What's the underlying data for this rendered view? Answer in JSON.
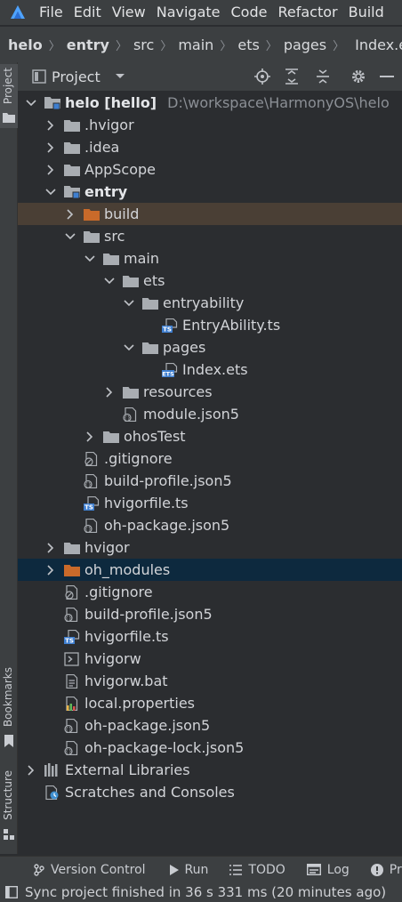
{
  "menu": [
    "File",
    "Edit",
    "View",
    "Navigate",
    "Code",
    "Refactor",
    "Build"
  ],
  "breadcrumb": [
    "helo",
    "entry",
    "src",
    "main",
    "ets",
    "pages",
    "Index.ets"
  ],
  "sidebar": {
    "project_tab": "Project",
    "bookmarks_tab": "Bookmarks",
    "structure_tab": "Structure"
  },
  "panel": {
    "title": "Project"
  },
  "tree": [
    {
      "label": "helo [hello]",
      "path": "D:\\workspace\\HarmonyOS\\helo",
      "level": 0,
      "expanded": true,
      "icon": "module-folder-icon",
      "bold": true
    },
    {
      "label": ".hvigor",
      "level": 1,
      "expanded": false,
      "icon": "folder-icon"
    },
    {
      "label": ".idea",
      "level": 1,
      "expanded": false,
      "icon": "folder-icon"
    },
    {
      "label": "AppScope",
      "level": 1,
      "expanded": false,
      "icon": "folder-icon"
    },
    {
      "label": "entry",
      "level": 1,
      "expanded": true,
      "icon": "module-folder-icon",
      "bold": true
    },
    {
      "label": "build",
      "level": 2,
      "expanded": false,
      "icon": "excluded-folder-icon",
      "selected": "brown"
    },
    {
      "label": "src",
      "level": 2,
      "expanded": true,
      "icon": "folder-icon"
    },
    {
      "label": "main",
      "level": 3,
      "expanded": true,
      "icon": "folder-icon"
    },
    {
      "label": "ets",
      "level": 4,
      "expanded": true,
      "icon": "folder-icon"
    },
    {
      "label": "entryability",
      "level": 5,
      "expanded": true,
      "icon": "folder-icon"
    },
    {
      "label": "EntryAbility.ts",
      "level": 6,
      "icon": "ts-file-icon"
    },
    {
      "label": "pages",
      "level": 5,
      "expanded": true,
      "icon": "folder-icon"
    },
    {
      "label": "Index.ets",
      "level": 6,
      "icon": "ets-file-icon"
    },
    {
      "label": "resources",
      "level": 4,
      "expanded": false,
      "icon": "folder-icon"
    },
    {
      "label": "module.json5",
      "level": 4,
      "icon": "json-file-icon"
    },
    {
      "label": "ohosTest",
      "level": 3,
      "expanded": false,
      "icon": "folder-icon"
    },
    {
      "label": ".gitignore",
      "level": 2,
      "icon": "ignore-file-icon"
    },
    {
      "label": "build-profile.json5",
      "level": 2,
      "icon": "json-file-icon"
    },
    {
      "label": "hvigorfile.ts",
      "level": 2,
      "icon": "ts-file-icon"
    },
    {
      "label": "oh-package.json5",
      "level": 2,
      "icon": "json-file-icon"
    },
    {
      "label": "hvigor",
      "level": 1,
      "expanded": false,
      "icon": "folder-icon"
    },
    {
      "label": "oh_modules",
      "level": 1,
      "expanded": false,
      "icon": "excluded-folder-icon",
      "selected": "blue"
    },
    {
      "label": ".gitignore",
      "level": 1,
      "icon": "ignore-file-icon"
    },
    {
      "label": "build-profile.json5",
      "level": 1,
      "icon": "json-file-icon"
    },
    {
      "label": "hvigorfile.ts",
      "level": 1,
      "icon": "ts-file-icon"
    },
    {
      "label": "hvigorw",
      "level": 1,
      "icon": "shell-file-icon"
    },
    {
      "label": "hvigorw.bat",
      "level": 1,
      "icon": "text-file-icon"
    },
    {
      "label": "local.properties",
      "level": 1,
      "icon": "properties-file-icon"
    },
    {
      "label": "oh-package.json5",
      "level": 1,
      "icon": "json-file-icon"
    },
    {
      "label": "oh-package-lock.json5",
      "level": 1,
      "icon": "json-file-icon"
    },
    {
      "label": "External Libraries",
      "level": 0,
      "expanded": false,
      "icon": "libraries-icon"
    },
    {
      "label": "Scratches and Consoles",
      "level": 0,
      "icon": "scratches-icon"
    }
  ],
  "toolbar": [
    {
      "label": "Version Control",
      "icon": "version-control-icon"
    },
    {
      "label": "Run",
      "icon": "run-icon"
    },
    {
      "label": "TODO",
      "icon": "todo-icon"
    },
    {
      "label": "Log",
      "icon": "log-icon"
    },
    {
      "label": "Prob",
      "icon": "problems-icon"
    }
  ],
  "status": {
    "message": "Sync project finished in 36 s 331 ms (20 minutes ago)"
  },
  "colors": {
    "background": "#2b2d30",
    "chrome": "#3c3f41",
    "folder": "#a9adb2",
    "excluded_folder": "#c96a2a",
    "selection_brown": "#4a3f35",
    "selection_blue": "#0d293e",
    "ts_badge": "#3f7fd0"
  }
}
